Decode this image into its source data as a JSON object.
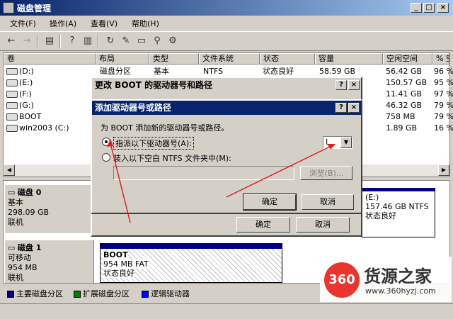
{
  "window": {
    "title": "磁盘管理",
    "min": "_",
    "max": "□",
    "close": "×"
  },
  "menu": [
    "文件(F)",
    "操作(A)",
    "查看(V)",
    "帮助(H)"
  ],
  "columns": [
    "卷",
    "布局",
    "类型",
    "文件系统",
    "状态",
    "容量",
    "空闲空间",
    "% 空"
  ],
  "volumes": [
    {
      "name": "(D:)",
      "layout": "磁盘分区",
      "type": "基本",
      "fs": "NTFS",
      "status": "状态良好",
      "cap": "58.59 GB",
      "free": "56.42 GB",
      "pct": "96 %"
    },
    {
      "name": "(E:)",
      "layout": "",
      "type": "",
      "fs": "",
      "status": "",
      "cap": "",
      "free": "150.57 GB",
      "pct": "95 %"
    },
    {
      "name": "(F:)",
      "layout": "",
      "type": "",
      "fs": "",
      "status": "",
      "cap": "",
      "free": "11.41 GB",
      "pct": "97 %"
    },
    {
      "name": "(G:)",
      "layout": "",
      "type": "",
      "fs": "",
      "status": "",
      "cap": "",
      "free": "46.32 GB",
      "pct": "79 %"
    },
    {
      "name": "BOOT",
      "layout": "",
      "type": "",
      "fs": "",
      "status": "",
      "cap": "",
      "free": "758 MB",
      "pct": "79 %"
    },
    {
      "name": "win2003 (C:)",
      "layout": "",
      "type": "",
      "fs": "",
      "status": "",
      "cap": "",
      "free": "1.89 GB",
      "pct": "16 %"
    }
  ],
  "disks": [
    {
      "name": "磁盘 0",
      "type": "基本",
      "size": "298.09 GB",
      "state": "联机"
    },
    {
      "name": "磁盘 1",
      "type": "可移动",
      "size": "954 MB",
      "state": "联机"
    }
  ],
  "disk0_partition": {
    "name": "(E:)",
    "info": "157.46 GB NTFS",
    "status": "状态良好"
  },
  "disk1_partition": {
    "name": "BOOT",
    "info": "954 MB FAT",
    "status": "状态良好"
  },
  "legend": [
    "主要磁盘分区",
    "扩展磁盘分区",
    "逻辑驱动器"
  ],
  "legend_colors": [
    "#000080",
    "#008000",
    "#0000ff"
  ],
  "outer_dialog": {
    "title": "更改 BOOT 的驱动器号和路径",
    "help": "?",
    "close": "×",
    "ok": "确定",
    "cancel": "取消"
  },
  "inner_dialog": {
    "title": "添加驱动器号或路径",
    "help": "?",
    "close": "×",
    "prompt": "为 BOOT 添加新的驱动器号或路径。",
    "option1": "指派以下驱动器号(A):",
    "option2": "装入以下空白 NTFS 文件夹中(M):",
    "drive_letter": "I",
    "browse": "浏览(B)...",
    "ok": "确定",
    "cancel": "取消"
  },
  "watermark": {
    "logo": "360",
    "brand": "货源之家",
    "url": "www.360hyzj.com"
  }
}
